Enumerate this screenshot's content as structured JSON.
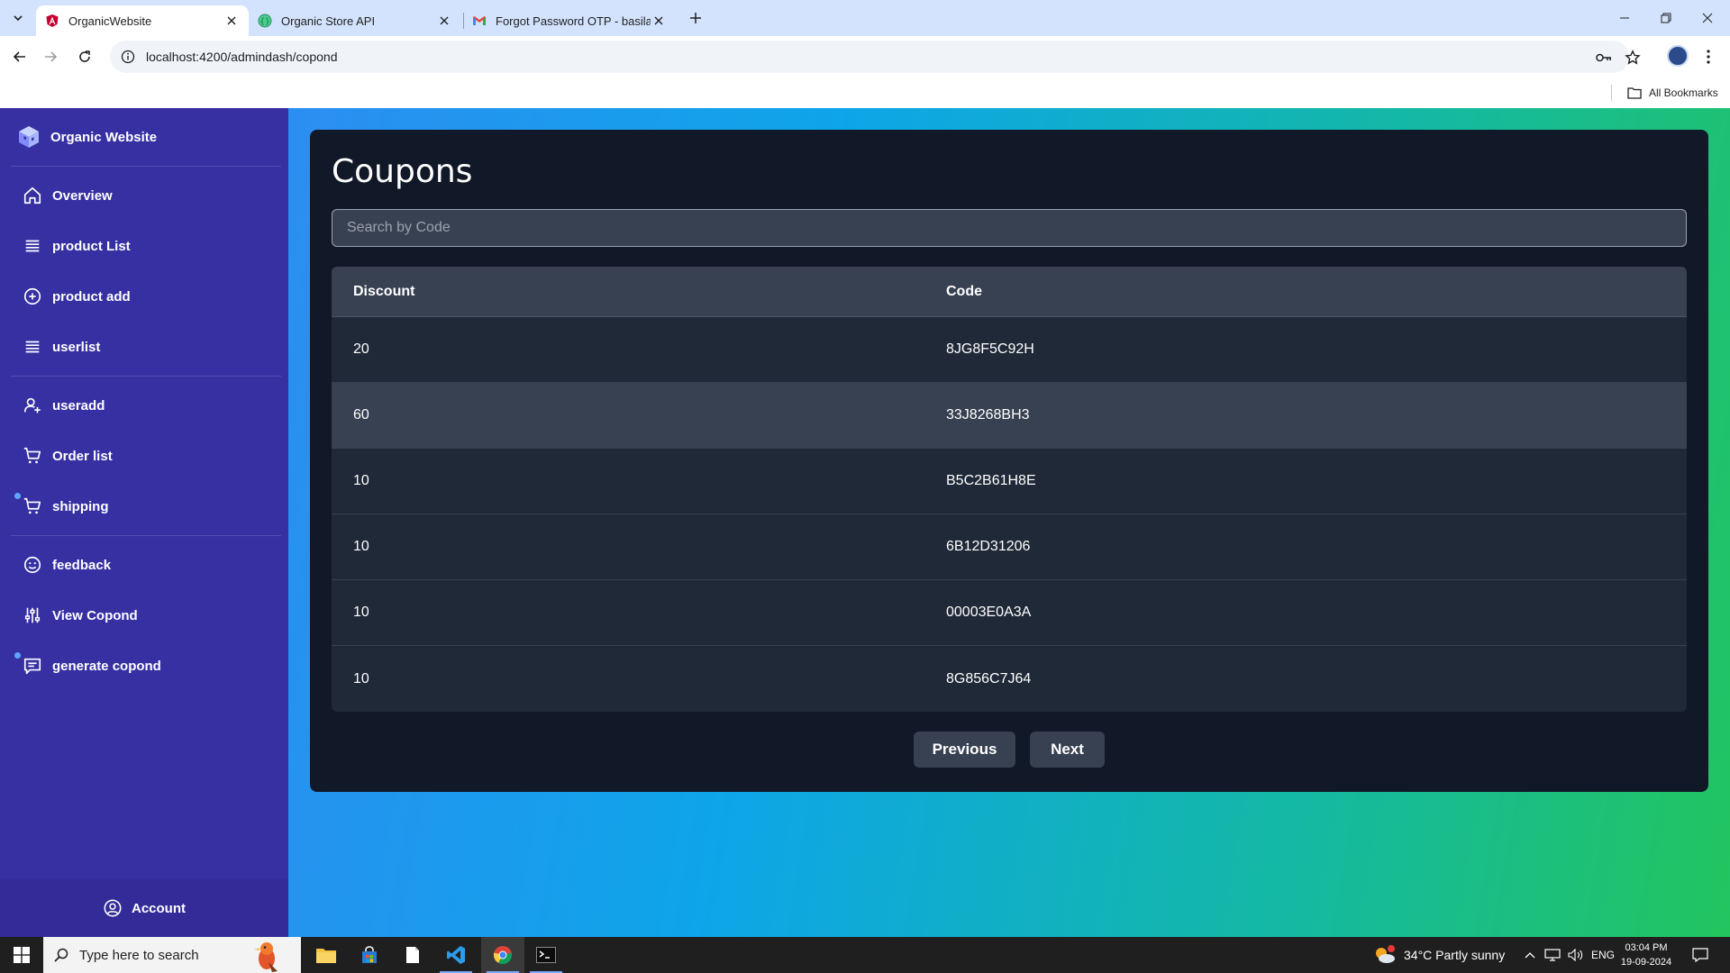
{
  "browser": {
    "tabs": [
      {
        "title": "OrganicWebsite",
        "active": true
      },
      {
        "title": "Organic Store API",
        "active": false
      },
      {
        "title": "Forgot Password OTP - basilaha",
        "active": false
      }
    ],
    "url": "localhost:4200/admindash/copond",
    "bookmarks_label": "All Bookmarks"
  },
  "sidebar": {
    "brand": "Organic Website",
    "items": [
      {
        "label": "Overview",
        "icon": "home-icon"
      },
      {
        "label": "product List",
        "icon": "list-icon"
      },
      {
        "label": "product add",
        "icon": "plus-circle-icon"
      },
      {
        "label": "userlist",
        "icon": "list-icon"
      },
      {
        "label": "useradd",
        "icon": "user-plus-icon"
      },
      {
        "label": "Order list",
        "icon": "cart-icon"
      },
      {
        "label": "shipping",
        "icon": "cart-icon"
      },
      {
        "label": "feedback",
        "icon": "smile-icon"
      },
      {
        "label": "View Copond",
        "icon": "sliders-icon"
      },
      {
        "label": "generate copond",
        "icon": "message-icon"
      }
    ],
    "account": "Account"
  },
  "main": {
    "title": "Coupons",
    "search_placeholder": "Search by Code",
    "columns": [
      "Discount",
      "Code"
    ],
    "rows": [
      {
        "discount": "20",
        "code": "8JG8F5C92H"
      },
      {
        "discount": "60",
        "code": "33J8268BH3"
      },
      {
        "discount": "10",
        "code": "B5C2B61H8E"
      },
      {
        "discount": "10",
        "code": "6B12D31206"
      },
      {
        "discount": "10",
        "code": "00003E0A3A"
      },
      {
        "discount": "10",
        "code": "8G856C7J64"
      }
    ],
    "previous": "Previous",
    "next": "Next"
  },
  "taskbar": {
    "search_placeholder": "Type here to search",
    "weather": "34°C  Partly sunny",
    "language": "ENG",
    "time": "03:04 PM",
    "date": "19-09-2024"
  },
  "colors": {
    "sidebar": "#3730a3",
    "card": "#111827",
    "table_row": "#1f2937",
    "table_header": "#374151"
  }
}
